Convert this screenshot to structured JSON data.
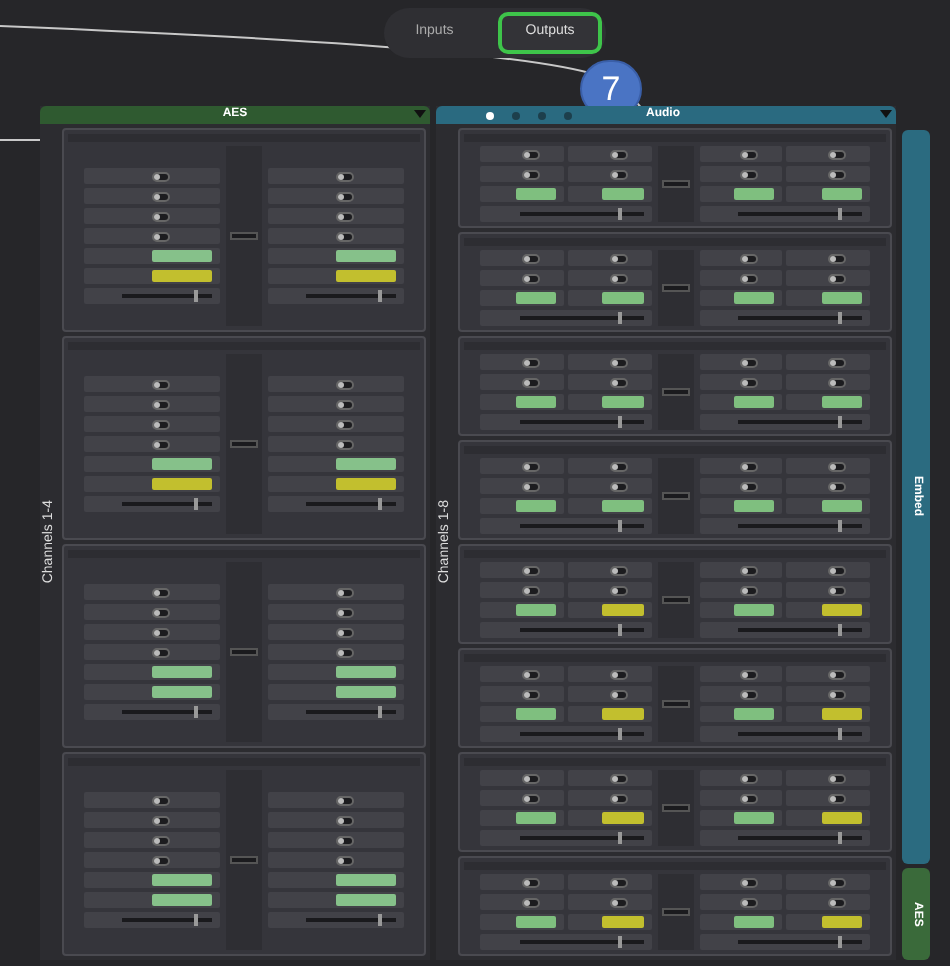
{
  "toggles": [
    {
      "on": false
    },
    {
      "on": false
    },
    {
      "on": false
    },
    {
      "on": false
    }
  ],
  "slider": {
    "level": 0.8
  },
  "tabs": [
    {
      "label": "Inputs",
      "selected": false
    },
    {
      "label": "Outputs",
      "selected": true
    }
  ],
  "callout": "7",
  "aes_panel": {
    "title": "AES",
    "side_label": "Channels 1-4",
    "channels": [
      {
        "fields": [
          {
            "color": "#86c18a"
          },
          {
            "color": "#c2bf2e"
          }
        ]
      },
      {
        "fields": [
          {
            "color": "#86c18a"
          },
          {
            "color": "#c2bf2e"
          }
        ]
      },
      {
        "fields": [
          {
            "color": "#86c18a"
          },
          {
            "color": "#86c18a"
          }
        ]
      },
      {
        "fields": [
          {
            "color": "#86c18a"
          },
          {
            "color": "#86c18a"
          }
        ]
      }
    ]
  },
  "audio_panel": {
    "title": "Audio",
    "side_label": "Channels 1-8",
    "radios": [
      {
        "selected": true
      },
      {
        "selected": false
      },
      {
        "selected": false
      },
      {
        "selected": false
      }
    ],
    "channels": [
      {
        "fields": [
          {
            "color": "#7fbf7f"
          },
          {
            "color": "#7fbf7f"
          }
        ]
      },
      {
        "fields": [
          {
            "color": "#7fbf7f"
          },
          {
            "color": "#7fbf7f"
          }
        ]
      },
      {
        "fields": [
          {
            "color": "#7fbf7f"
          },
          {
            "color": "#7fbf7f"
          }
        ]
      },
      {
        "fields": [
          {
            "color": "#7fbf7f"
          },
          {
            "color": "#7fbf7f"
          }
        ]
      },
      {
        "fields": [
          {
            "color": "#7fbf7f"
          },
          {
            "color": "#c2bf2e"
          }
        ]
      },
      {
        "fields": [
          {
            "color": "#7fbf7f"
          },
          {
            "color": "#c2bf2e"
          }
        ]
      },
      {
        "fields": [
          {
            "color": "#7fbf7f"
          },
          {
            "color": "#c2bf2e"
          }
        ]
      },
      {
        "fields": [
          {
            "color": "#7fbf7f"
          },
          {
            "color": "#c2bf2e"
          }
        ]
      }
    ]
  },
  "side_tabs": [
    {
      "label": "Embed",
      "color": "#2b6b80"
    },
    {
      "label": "AES",
      "color": "#3a6a3a"
    }
  ]
}
